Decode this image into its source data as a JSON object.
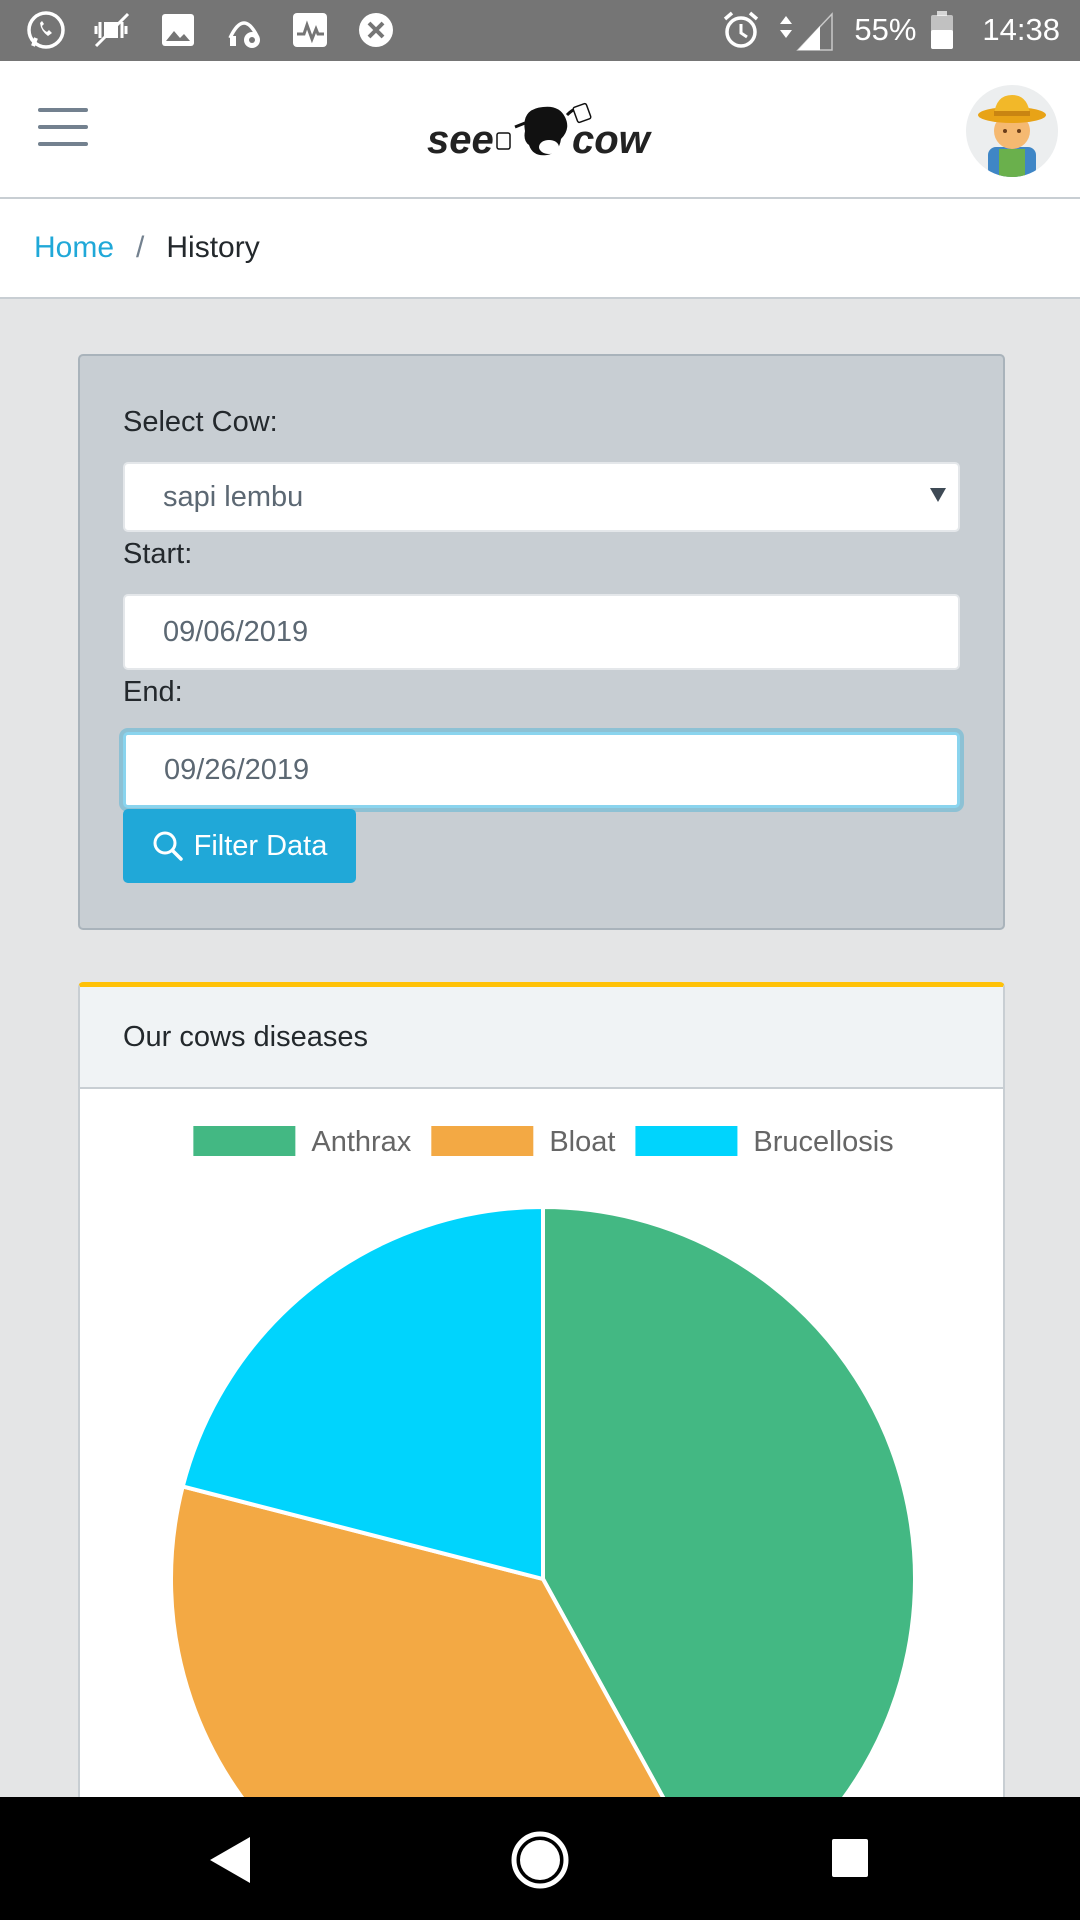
{
  "status_bar": {
    "battery": "55%",
    "time": "14:38",
    "network": "4G+",
    "left_icons": [
      "whatsapp-icon",
      "mute-icon",
      "image-icon",
      "settings-icon",
      "activity-icon",
      "close-circle-icon"
    ]
  },
  "header": {
    "logo_text_left": "see",
    "logo_text_right": "cow",
    "menu_icon": "hamburger-icon",
    "avatar_icon": "farmer-avatar-icon"
  },
  "breadcrumb": {
    "home": "Home",
    "separator": "/",
    "current": "History"
  },
  "filter": {
    "cow_label": "Select Cow:",
    "cow_value": "sapi lembu",
    "start_label": "Start:",
    "start_value": "09/06/2019",
    "end_label": "End:",
    "end_value": "09/26/2019",
    "button_label": "Filter Data"
  },
  "chart_card": {
    "title": "Our cows diseases"
  },
  "chart_data": {
    "type": "pie",
    "categories": [
      "Anthrax",
      "Bloat",
      "Brucellosis"
    ],
    "values": [
      42,
      37,
      21
    ],
    "colors": [
      "#43b883",
      "#f3a944",
      "#00d4fd"
    ],
    "legend_position": "top"
  },
  "colors": {
    "accent": "#20a8d8",
    "card_top_border": "#ffc107"
  }
}
